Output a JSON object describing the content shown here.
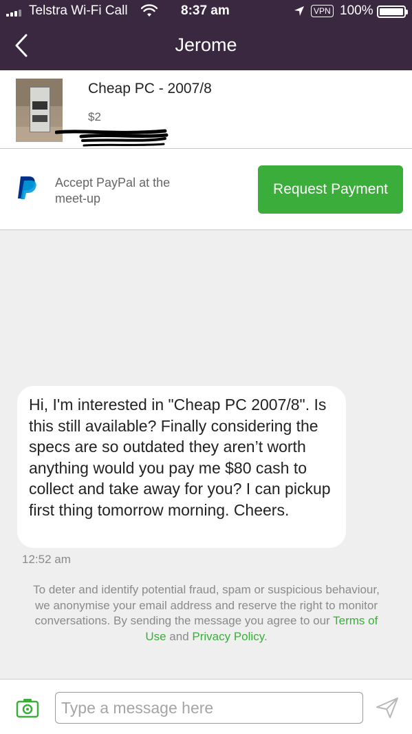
{
  "status_bar": {
    "carrier": "Telstra Wi-Fi Call",
    "time": "8:37 am",
    "vpn": "VPN",
    "battery": "100%"
  },
  "nav": {
    "title": "Jerome",
    "back_icon": "chevron-left-icon"
  },
  "listing": {
    "title": "Cheap PC - 2007/8",
    "price": "$2"
  },
  "paypal": {
    "text": "Accept PayPal at the meet-up",
    "button_label": "Request Payment",
    "icon": "paypal-icon"
  },
  "conversation": {
    "message": "Hi, I'm interested in \"Cheap PC 2007/8\". Is this still available? Finally considering the specs are so outdated they aren’t worth anything would you pay me $80 cash to collect and take away for you? I can pickup first thing tomorrow morning. Cheers.",
    "timestamp": "12:52 am"
  },
  "notice": {
    "text": "To deter and identify potential fraud, spam or suspicious behaviour, we anonymise your email address and reserve the right to monitor conversations. By sending the message you agree to our",
    "terms_link": "Terms of Use",
    "and": "and",
    "privacy_link": "Privacy Policy",
    "end": "."
  },
  "composer": {
    "placeholder": "Type a message here",
    "camera_icon": "camera-icon",
    "send_icon": "send-icon"
  },
  "colors": {
    "header_bg": "#3a2840",
    "accent_green": "#3aad3a",
    "background": "#efefef"
  }
}
